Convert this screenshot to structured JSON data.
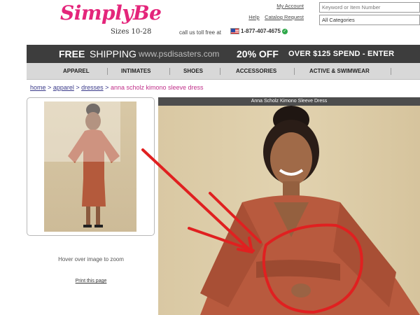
{
  "header": {
    "brand": "SimplyBe",
    "sizes": "Sizes 10-28",
    "my_account": "My Account",
    "help": "Help",
    "catalog_request": "Catalog Request",
    "toll_free": "call us toll free at",
    "phone": "1-877-407-4675",
    "search_placeholder": "Keyword or Item Number",
    "category": "All Categories"
  },
  "promo": {
    "free": "FREE",
    "shipping": "SHIPPING",
    "site": "www.psdisasters.com",
    "discount": "20% OFF",
    "spend": "OVER $125 SPEND - ENTER"
  },
  "nav": [
    "APPAREL",
    "INTIMATES",
    "SHOES",
    "ACCESSORIES",
    "ACTIVE & SWIMWEAR"
  ],
  "breadcrumb": {
    "home": "home",
    "apparel": "apparel",
    "dresses": "dresses",
    "separator": ">",
    "current": "anna scholz kimono sleeve dress"
  },
  "product": {
    "title": "Anna Scholz Kimono Sleeve Dress",
    "hover_text": "Hover over image to zoom",
    "print_link": "Print this page"
  },
  "colors": {
    "brand_pink": "#e4257b",
    "promo_bar": "#3d3d3d",
    "nav_bar": "#d8d8d8",
    "dress": "#b85a3e",
    "annotation_red": "#e02020"
  }
}
